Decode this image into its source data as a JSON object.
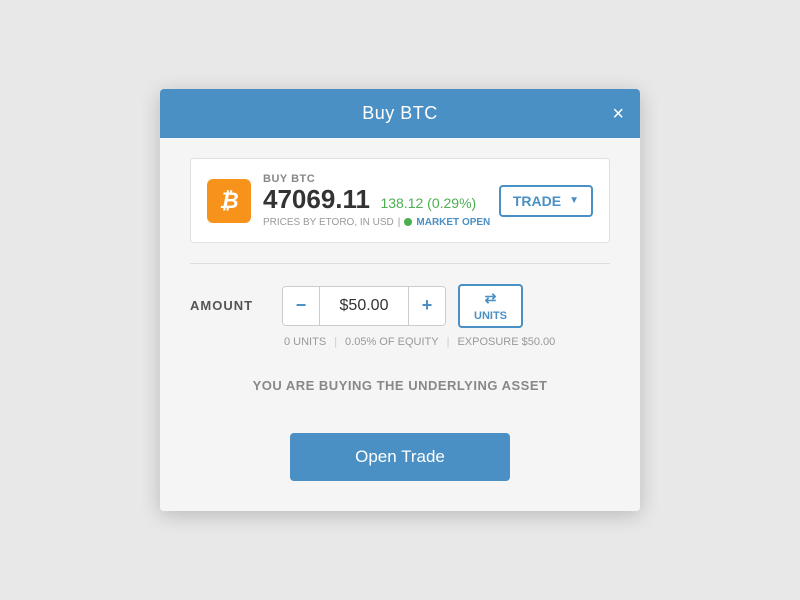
{
  "modal": {
    "title": "Buy BTC",
    "close_label": "×"
  },
  "asset": {
    "label": "BUY BTC",
    "price": "47069.11",
    "change": "138.12 (0.29%)",
    "source": "PRICES BY ETORO, IN USD",
    "market_status": "MARKET OPEN",
    "icon_symbol": "₿"
  },
  "trade_dropdown": {
    "label": "TRADE",
    "chevron": "▼"
  },
  "amount_section": {
    "label": "AMOUNT",
    "value": "$50.00",
    "minus_label": "−",
    "plus_label": "+",
    "units_icon": "⇄",
    "units_label": "UNITS"
  },
  "amount_meta": {
    "units": "0 UNITS",
    "equity": "0.05% OF EQUITY",
    "exposure": "EXPOSURE $50.00"
  },
  "message": "YOU ARE BUYING THE UNDERLYING ASSET",
  "open_trade_button": "Open Trade"
}
